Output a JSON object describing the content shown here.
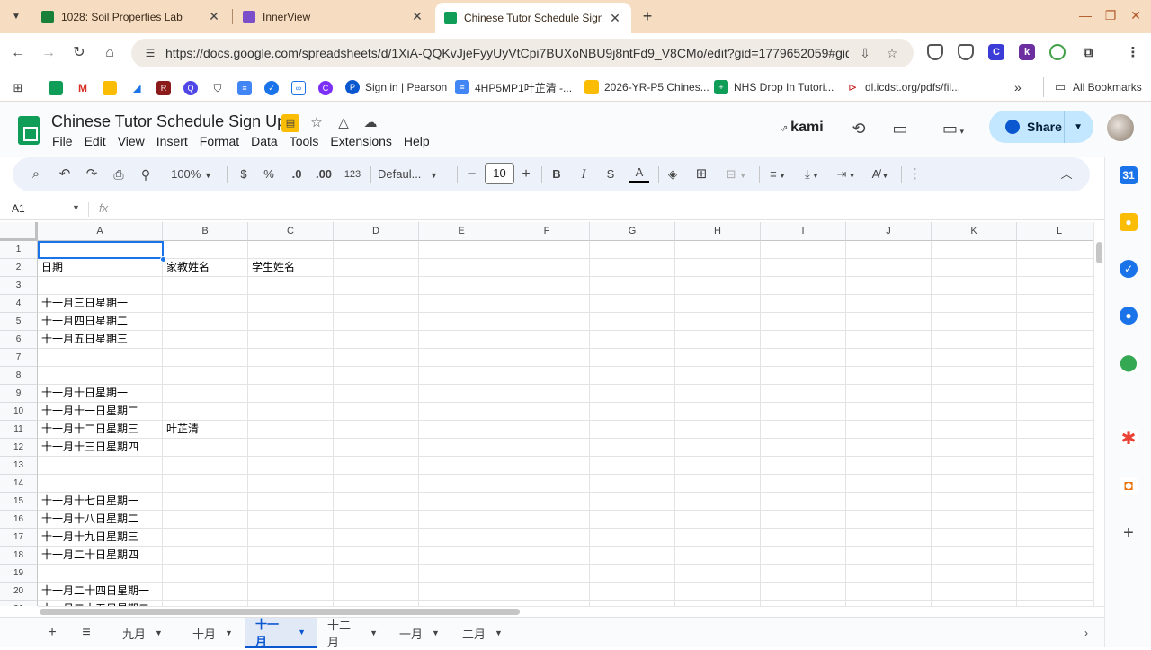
{
  "browser": {
    "tabs": [
      {
        "title": "1028: Soil Properties Lab",
        "favicon_color": "#188038"
      },
      {
        "title": "InnerView",
        "favicon_color": "#7b4fc9"
      },
      {
        "title": "Chinese Tutor Schedule Sign U",
        "favicon_color": "#0f9d58"
      }
    ],
    "url": "https://docs.google.com/spreadsheets/d/1XiA-QQKvJjeFyyUyVtCpi7BUXoNBU9j8ntFd9_V8CMo/edit?gid=1779652059#gid=177...",
    "bookmarks": [
      {
        "label": "Sign in | Pearson",
        "color": "#0b57d0"
      },
      {
        "label": "4HP5MP1叶芷清 -...",
        "color": "#4285f4"
      },
      {
        "label": "2026-YR-P5 Chines...",
        "color": "#fbbc04"
      },
      {
        "label": "NHS Drop In Tutori...",
        "color": "#0f9d58"
      },
      {
        "label": "dl.icdst.org/pdfs/fil...",
        "color": "#c5221f"
      }
    ],
    "all_bookmarks": "All Bookmarks",
    "more_bookmarks": "»"
  },
  "doc": {
    "title": "Chinese Tutor Schedule Sign Up",
    "menu": [
      "File",
      "Edit",
      "View",
      "Insert",
      "Format",
      "Data",
      "Tools",
      "Extensions",
      "Help"
    ],
    "kami": "kami",
    "share": "Share"
  },
  "toolbar": {
    "zoom": "100%",
    "currency": "$",
    "percent": "%",
    "dec_decrease": ".0",
    "dec_increase": ".00",
    "number_format": "123",
    "font": "Defaul...",
    "font_size": "10",
    "bold": "B",
    "italic": "I",
    "strike": "S",
    "text_color": "A"
  },
  "formula_bar": {
    "cell_ref": "A1",
    "fx": "fx"
  },
  "grid": {
    "columns": [
      "A",
      "B",
      "C",
      "D",
      "E",
      "F",
      "G",
      "H",
      "I",
      "J",
      "K",
      "L"
    ],
    "rows": [
      {
        "num": "1",
        "cells": [
          "",
          "",
          ""
        ]
      },
      {
        "num": "2",
        "cells": [
          "日期",
          "家教姓名",
          "学生姓名"
        ]
      },
      {
        "num": "3",
        "cells": [
          "",
          "",
          ""
        ]
      },
      {
        "num": "4",
        "cells": [
          "十一月三日星期一",
          "",
          ""
        ]
      },
      {
        "num": "5",
        "cells": [
          "十一月四日星期二",
          "",
          ""
        ]
      },
      {
        "num": "6",
        "cells": [
          "十一月五日星期三",
          "",
          ""
        ]
      },
      {
        "num": "7",
        "cells": [
          "",
          "",
          ""
        ]
      },
      {
        "num": "8",
        "cells": [
          "",
          "",
          ""
        ]
      },
      {
        "num": "9",
        "cells": [
          "十一月十日星期一",
          "",
          ""
        ]
      },
      {
        "num": "10",
        "cells": [
          "十一月十一日星期二",
          "",
          ""
        ]
      },
      {
        "num": "11",
        "cells": [
          "十一月十二日星期三",
          "叶芷清",
          ""
        ]
      },
      {
        "num": "12",
        "cells": [
          "十一月十三日星期四",
          "",
          ""
        ]
      },
      {
        "num": "13",
        "cells": [
          "",
          "",
          ""
        ]
      },
      {
        "num": "14",
        "cells": [
          "",
          "",
          ""
        ]
      },
      {
        "num": "15",
        "cells": [
          "十一月十七日星期一",
          "",
          ""
        ]
      },
      {
        "num": "16",
        "cells": [
          "十一月十八日星期二",
          "",
          ""
        ]
      },
      {
        "num": "17",
        "cells": [
          "十一月十九日星期三",
          "",
          ""
        ]
      },
      {
        "num": "18",
        "cells": [
          "十一月二十日星期四",
          "",
          ""
        ]
      },
      {
        "num": "19",
        "cells": [
          "",
          "",
          ""
        ]
      },
      {
        "num": "20",
        "cells": [
          "十一月二十四日星期一",
          "",
          ""
        ]
      },
      {
        "num": "21",
        "cells": [
          "十一月二十五日星期二",
          "",
          ""
        ]
      }
    ]
  },
  "sheet_tabs": [
    {
      "label": "九月",
      "active": false
    },
    {
      "label": "十月",
      "active": false
    },
    {
      "label": "十一月",
      "active": true
    },
    {
      "label": "十二月",
      "active": false
    },
    {
      "label": "一月",
      "active": false
    },
    {
      "label": "二月",
      "active": false
    }
  ],
  "colors": {
    "accent": "#0b57d0",
    "selection": "#1a73e8",
    "browser_frame": "#f6dcc0"
  }
}
